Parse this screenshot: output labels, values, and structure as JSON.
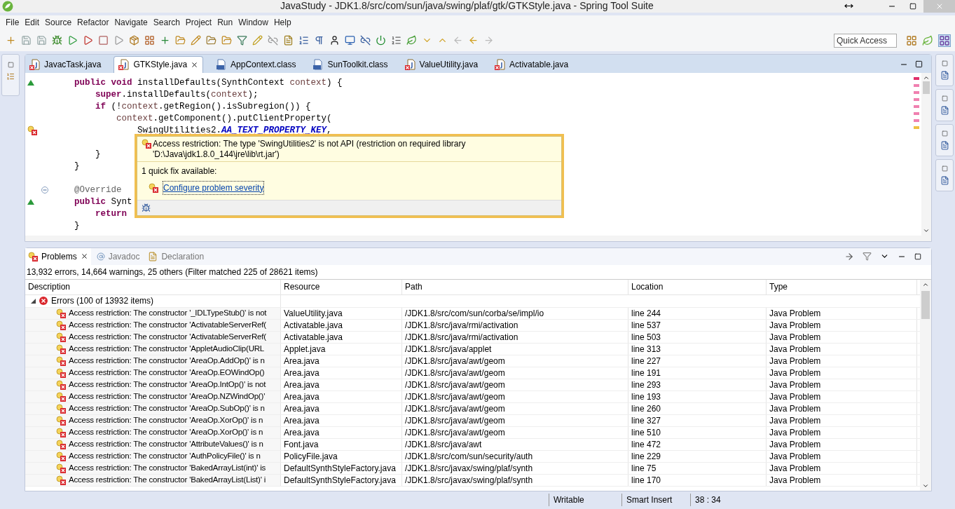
{
  "window": {
    "title": "JavaStudy - JDK1.8/src/com/sun/java/swing/plaf/gtk/GTKStyle.java - Spring Tool Suite"
  },
  "menu": [
    "File",
    "Edit",
    "Source",
    "Refactor",
    "Navigate",
    "Search",
    "Project",
    "Run",
    "Window",
    "Help"
  ],
  "quick_access": {
    "placeholder": "Quick Access"
  },
  "editor_tabs": [
    {
      "label": "JavacTask.java",
      "kind": "java",
      "selected": false
    },
    {
      "label": "GTKStyle.java",
      "kind": "java",
      "selected": true
    },
    {
      "label": "AppContext.class",
      "kind": "class",
      "selected": false
    },
    {
      "label": "SunToolkit.class",
      "kind": "class",
      "selected": false
    },
    {
      "label": "ValueUtility.java",
      "kind": "java",
      "selected": false
    },
    {
      "label": "Activatable.java",
      "kind": "java",
      "selected": false
    }
  ],
  "code_lines": [
    {
      "kind": "override",
      "tokens": [
        {
          "kind": "keyword",
          "text": "public void"
        },
        {
          "kind": "plain",
          "text": " installDefaults(SynthContext "
        },
        {
          "kind": "param",
          "text": "context"
        },
        {
          "kind": "plain",
          "text": ") {"
        }
      ]
    },
    {
      "kind": "plain",
      "tokens": [
        {
          "kind": "keyword",
          "text": "super"
        },
        {
          "kind": "plain",
          "text": ".installDefaults("
        },
        {
          "kind": "param",
          "text": "context"
        },
        {
          "kind": "plain",
          "text": ");"
        }
      ]
    },
    {
      "kind": "plain",
      "tokens": [
        {
          "kind": "keyword",
          "text": "if"
        },
        {
          "kind": "plain",
          "text": " (!"
        },
        {
          "kind": "param",
          "text": "context"
        },
        {
          "kind": "plain",
          "text": ".getRegion().isSubregion()) {"
        }
      ]
    },
    {
      "kind": "plain",
      "tokens": [
        {
          "kind": "param",
          "text": "context"
        },
        {
          "kind": "plain",
          "text": ".getComponent().putClientProperty("
        }
      ]
    },
    {
      "kind": "error",
      "tokens": [
        {
          "kind": "error",
          "text": "SwingUtilities2"
        },
        {
          "kind": "plain",
          "text": "."
        },
        {
          "kind": "static",
          "text": "AA_TEXT_PROPERTY_KEY"
        },
        {
          "kind": "plain",
          "text": ","
        }
      ]
    },
    {
      "kind": "plain"
    },
    {
      "kind": "plain",
      "tokens": [
        {
          "kind": "plain",
          "text": "}"
        }
      ]
    },
    {
      "kind": "plain",
      "tokens": [
        {
          "kind": "plain",
          "text": "}"
        }
      ]
    },
    {
      "kind": "plain"
    },
    {
      "kind": "fold",
      "tokens": [
        {
          "kind": "annotation",
          "text": "@Override"
        }
      ]
    },
    {
      "kind": "override",
      "tokens": [
        {
          "kind": "keyword",
          "text": "public"
        },
        {
          "kind": "plain",
          "text": " Synt"
        }
      ]
    },
    {
      "kind": "plain",
      "tokens": [
        {
          "kind": "keyword",
          "text": "return"
        }
      ]
    },
    {
      "kind": "plain",
      "tokens": [
        {
          "kind": "plain",
          "text": "}"
        }
      ]
    }
  ],
  "hover": {
    "message": "Access restriction: The type 'SwingUtilities2' is not API (restriction on required library 'D:\\Java\\jdk1.8.0_144\\jre\\lib\\rt.jar')",
    "fix_count": "1 quick fix available:",
    "fix": "Configure problem severity"
  },
  "view_tabs": [
    {
      "label": "Problems",
      "kind": "problems",
      "selected": true
    },
    {
      "label": "Javadoc",
      "kind": "javadoc",
      "selected": false
    },
    {
      "label": "Declaration",
      "kind": "declaration",
      "selected": false
    }
  ],
  "summary": "13,932 errors, 14,664 warnings, 25 others (Filter matched 225 of 28621 items)",
  "table": {
    "columns": [
      "Description",
      "Resource",
      "Path",
      "Location",
      "Type"
    ],
    "group": {
      "label": "Errors (100 of 13932 items)",
      "expanded": true
    },
    "rows": [
      [
        "Access restriction: The constructor '_IDLTypeStub()' is not",
        "ValueUtility.java",
        "/JDK1.8/src/com/sun/corba/se/impl/io",
        "line 244",
        "Java Problem"
      ],
      [
        "Access restriction: The constructor 'ActivatableServerRef(",
        "Activatable.java",
        "/JDK1.8/src/java/rmi/activation",
        "line 537",
        "Java Problem"
      ],
      [
        "Access restriction: The constructor 'ActivatableServerRef(",
        "Activatable.java",
        "/JDK1.8/src/java/rmi/activation",
        "line 503",
        "Java Problem"
      ],
      [
        "Access restriction: The constructor 'AppletAudioClip(URL",
        "Applet.java",
        "/JDK1.8/src/java/applet",
        "line 313",
        "Java Problem"
      ],
      [
        "Access restriction: The constructor 'AreaOp.AddOp()' is n",
        "Area.java",
        "/JDK1.8/src/java/awt/geom",
        "line 227",
        "Java Problem"
      ],
      [
        "Access restriction: The constructor 'AreaOp.EOWindOp()",
        "Area.java",
        "/JDK1.8/src/java/awt/geom",
        "line 191",
        "Java Problem"
      ],
      [
        "Access restriction: The constructor 'AreaOp.IntOp()' is not",
        "Area.java",
        "/JDK1.8/src/java/awt/geom",
        "line 293",
        "Java Problem"
      ],
      [
        "Access restriction: The constructor 'AreaOp.NZWindOp()'",
        "Area.java",
        "/JDK1.8/src/java/awt/geom",
        "line 193",
        "Java Problem"
      ],
      [
        "Access restriction: The constructor 'AreaOp.SubOp()' is n",
        "Area.java",
        "/JDK1.8/src/java/awt/geom",
        "line 260",
        "Java Problem"
      ],
      [
        "Access restriction: The constructor 'AreaOp.XorOp()' is n",
        "Area.java",
        "/JDK1.8/src/java/awt/geom",
        "line 327",
        "Java Problem"
      ],
      [
        "Access restriction: The constructor 'AreaOp.XorOp()' is n",
        "Area.java",
        "/JDK1.8/src/java/awt/geom",
        "line 510",
        "Java Problem"
      ],
      [
        "Access restriction: The constructor 'AttributeValues()' is n",
        "Font.java",
        "/JDK1.8/src/java/awt",
        "line 472",
        "Java Problem"
      ],
      [
        "Access restriction: The constructor 'AuthPolicyFile()' is n",
        "PolicyFile.java",
        "/JDK1.8/src/com/sun/security/auth",
        "line 229",
        "Java Problem"
      ],
      [
        "Access restriction: The constructor 'BakedArrayList(int)' is",
        "DefaultSynthStyleFactory.java",
        "/JDK1.8/src/javax/swing/plaf/synth",
        "line 75",
        "Java Problem"
      ],
      [
        "Access restriction: The constructor 'BakedArrayList(List)' i",
        "DefaultSynthStyleFactory.java",
        "/JDK1.8/src/javax/swing/plaf/synth",
        "line 170",
        "Java Problem"
      ]
    ]
  },
  "status_bar": [
    "Writable",
    "Smart Insert",
    "38 : 34"
  ]
}
